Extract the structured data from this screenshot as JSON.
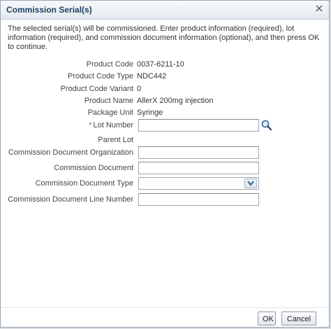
{
  "dialog": {
    "title": "Commission Serial(s)",
    "close_icon": "close-icon",
    "intro": "The selected serial(s) will be commissioned. Enter product information (required), lot information (required), and commission document information (optional), and then press OK to continue."
  },
  "form": {
    "product_code": {
      "label": "Product Code",
      "value": "0037-6211-10"
    },
    "product_code_type": {
      "label": "Product Code Type",
      "value": "NDC442"
    },
    "product_code_variant": {
      "label": "Product Code Variant",
      "value": "0"
    },
    "product_name": {
      "label": "Product Name",
      "value": "AllerX 200mg injection"
    },
    "package_unit": {
      "label": "Package Unit",
      "value": "Syringe"
    },
    "lot_number": {
      "required_marker": "*",
      "label": "Lot Number",
      "value": ""
    },
    "parent_lot": {
      "label": "Parent Lot",
      "value": ""
    },
    "commission_document_organization": {
      "label": "Commission Document Organization",
      "value": ""
    },
    "commission_document": {
      "label": "Commission Document",
      "value": ""
    },
    "commission_document_type": {
      "label": "Commission Document Type",
      "value": ""
    },
    "commission_document_line_number": {
      "label": "Commission Document Line Number",
      "value": ""
    }
  },
  "buttons": {
    "ok": "OK",
    "cancel": "Cancel"
  },
  "colors": {
    "title": "#1f3f66",
    "required": "#4a6fa0"
  }
}
